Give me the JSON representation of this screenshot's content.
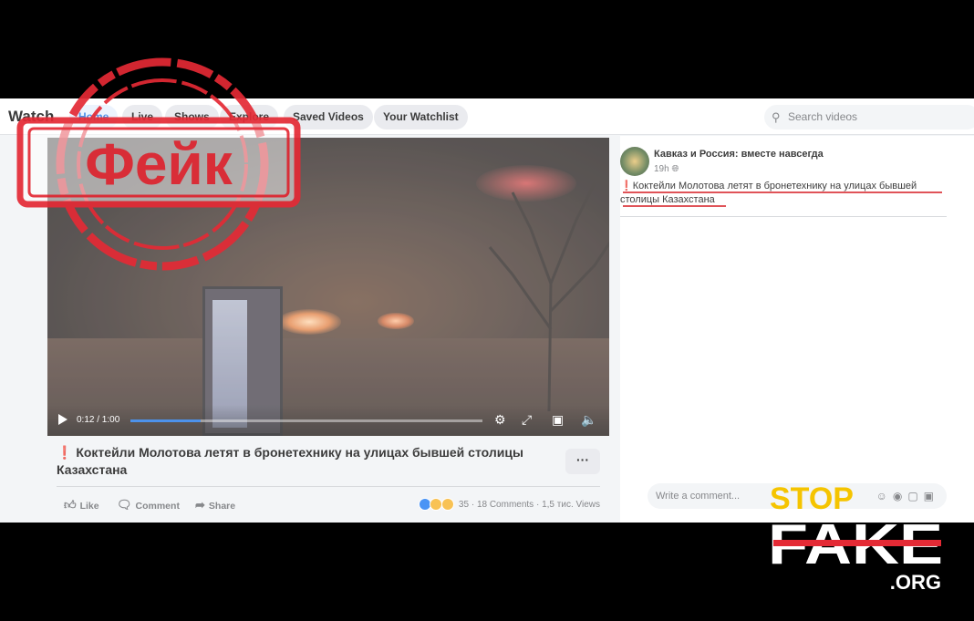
{
  "nav": {
    "brand": "Watch",
    "tabs": [
      "Home",
      "Live",
      "Shows",
      "Explore",
      "Saved Videos",
      "Your Watchlist"
    ],
    "active_tab": "Home",
    "search_placeholder": "Search videos"
  },
  "video": {
    "time": "0:12 / 1:00",
    "progress": 0.2,
    "title": "Коктейли Молотова летят в бронетехнику на улицах бывшей столицы Казахстана",
    "title_mark": "❗",
    "more_label": "···"
  },
  "actions": {
    "like": "Like",
    "comment": "Comment",
    "share": "Share",
    "reactions_count": "35",
    "comments": "18 Comments",
    "views": "1,5 тис. Views",
    "sep": "·"
  },
  "right_post": {
    "author": "Кавказ и Россия: вместе навсегда",
    "time": "19h",
    "privacy_icon": "globe-icon",
    "text": "Коктейли Молотова летят в бронетехнику на улицах бывшей столицы Казахстана",
    "text_mark": "❗",
    "comment_placeholder": "Write a comment..."
  },
  "stamp": {
    "text": "Фейк",
    "color": "#e42a35"
  },
  "logo": {
    "stop": "STOP",
    "fake": "FAKE",
    "org": ".ORG",
    "stop_color": "#f5c400",
    "strike_color": "#e42a35"
  },
  "colors": {
    "fb_blue": "#1b74e4",
    "fb_bg": "#f0f2f5"
  }
}
